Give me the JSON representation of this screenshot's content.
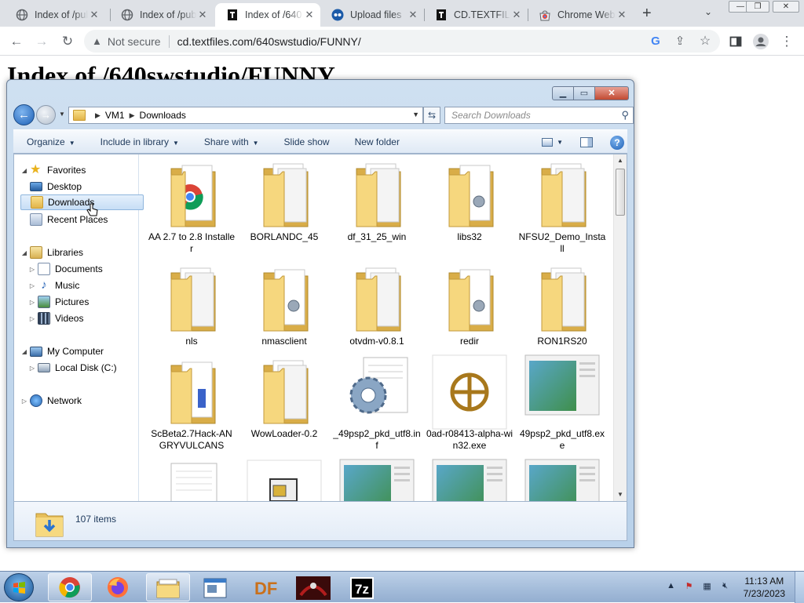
{
  "browser": {
    "tabs": [
      {
        "title": "Index of /pub",
        "icon": "globe-icon",
        "active": false
      },
      {
        "title": "Index of /pub",
        "icon": "globe-icon",
        "active": false
      },
      {
        "title": "Index of /640",
        "icon": "textfiles-icon",
        "active": true
      },
      {
        "title": "Upload files",
        "icon": "upload-service-icon",
        "active": false
      },
      {
        "title": "CD.TEXTFILE",
        "icon": "textfiles-icon",
        "active": false
      },
      {
        "title": "Chrome Web",
        "icon": "chrome-web-store-icon",
        "active": false
      }
    ],
    "security_label": "Not secure",
    "url": "cd.textfiles.com/640swstudio/FUNNY/",
    "colors": {
      "tabbar": "#dee1e6",
      "omnibox": "#f1f3f4"
    }
  },
  "page": {
    "heading": "Index of /640swstudio/FUNNY"
  },
  "explorer": {
    "breadcrumb": [
      "VM1",
      "Downloads"
    ],
    "search_placeholder": "Search Downloads",
    "commands": [
      "Organize",
      "Include in library",
      "Share with",
      "Slide show",
      "New folder"
    ],
    "nav": {
      "favorites": {
        "label": "Favorites",
        "items": [
          "Desktop",
          "Downloads",
          "Recent Places"
        ]
      },
      "libraries": {
        "label": "Libraries",
        "items": [
          "Documents",
          "Music",
          "Pictures",
          "Videos"
        ]
      },
      "computer": {
        "label": "My Computer",
        "items": [
          "Local Disk (C:)"
        ]
      },
      "network": {
        "label": "Network"
      },
      "selected": "Downloads"
    },
    "files": [
      {
        "name": "AA 2.7 to 2.8 Installer",
        "kind": "folder-chrome"
      },
      {
        "name": "BORLANDC_45",
        "kind": "folder-docs"
      },
      {
        "name": "df_31_25_win",
        "kind": "folder-docs"
      },
      {
        "name": "libs32",
        "kind": "folder-gear"
      },
      {
        "name": "NFSU2_Demo_Install",
        "kind": "folder-docs"
      },
      {
        "name": "nls",
        "kind": "folder-docs"
      },
      {
        "name": "nmasclient",
        "kind": "folder-gear"
      },
      {
        "name": "otvdm-v0.8.1",
        "kind": "folder-docs"
      },
      {
        "name": "redir",
        "kind": "folder-gear"
      },
      {
        "name": "RON1RS20",
        "kind": "folder-docs"
      },
      {
        "name": "ScBeta2.7Hack-ANGRYVULCANS",
        "kind": "folder-blue"
      },
      {
        "name": "WowLoader-0.2",
        "kind": "folder-docs"
      },
      {
        "name": "_49psp2_pkd_utf8.inf",
        "kind": "gear-file"
      },
      {
        "name": "0ad-r08413-alpha-win32.exe",
        "kind": "exe-0ad"
      },
      {
        "name": "49psp2_pkd_utf8.exe",
        "kind": "exe-window"
      },
      {
        "name": "",
        "kind": "text-file"
      },
      {
        "name": "",
        "kind": "exe-setup"
      },
      {
        "name": "",
        "kind": "exe-window"
      },
      {
        "name": "",
        "kind": "exe-window"
      },
      {
        "name": "",
        "kind": "exe-window"
      }
    ],
    "item_count": "107 items"
  },
  "taskbar": {
    "apps": [
      "chrome-icon",
      "firefox-icon",
      "file-explorer-icon",
      "window-icon",
      "df-icon",
      "game-icon",
      "7zip-icon"
    ],
    "df_label": "DF",
    "sevenzip_label": "7z",
    "time": "11:13 AM",
    "date": "7/23/2023"
  }
}
